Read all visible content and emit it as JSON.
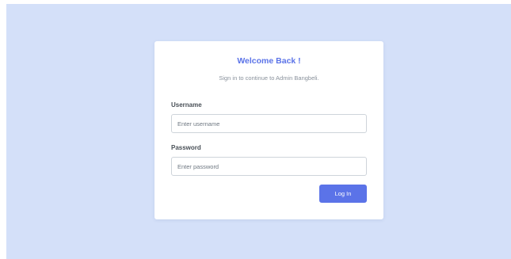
{
  "login": {
    "title": "Welcome Back !",
    "subtitle": "Sign in to continue to Admin Bangbeli.",
    "username": {
      "label": "Username",
      "placeholder": "Enter username",
      "value": ""
    },
    "password": {
      "label": "Password",
      "placeholder": "Enter password",
      "value": ""
    },
    "submit_label": "Log In"
  },
  "colors": {
    "page_background": "#d4e0f9",
    "accent": "#5b73e8",
    "card_background": "#ffffff"
  }
}
